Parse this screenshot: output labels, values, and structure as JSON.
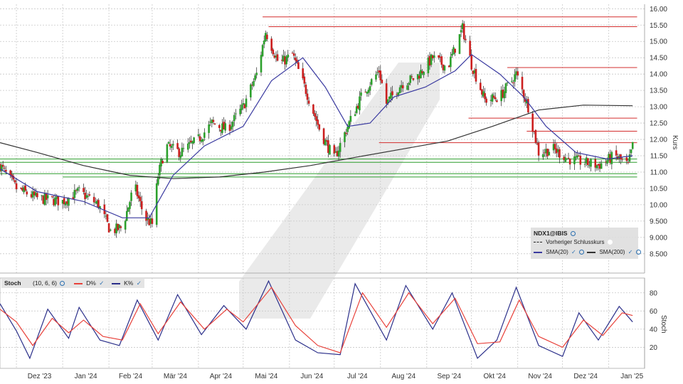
{
  "colors": {
    "up_candle": "#2ca02c",
    "down_candle": "#cc1f1f",
    "sma20": "#3a3aa0",
    "sma200": "#333333",
    "resistance": "#d32f2f",
    "support": "#2e9e2e",
    "stoch_d": "#e8413a",
    "stoch_k": "#2b2f8a",
    "grid": "#c8c8c8"
  },
  "legend": {
    "symbol": "NDX1@IBIS",
    "previous_close": "Vorheriger Schlusskurs",
    "sma20": "SMA(20)",
    "sma200": "SMA(200)"
  },
  "stoch_legend": {
    "name": "Stoch",
    "params": "(10, 6, 6)",
    "d": "D%",
    "k": "K%"
  },
  "chart_data": [
    {
      "type": "candlestick",
      "ylabel": "Kurs",
      "ylim": [
        8.0,
        16.2
      ],
      "yticks": [
        "16.00",
        "15.50",
        "15.00",
        "14.50",
        "14.00",
        "13.50",
        "13.00",
        "12.50",
        "12.00",
        "11.50",
        "11.00",
        "10.50",
        "10.00",
        "9.500",
        "9.000",
        "8.500"
      ],
      "xticks": [
        "Dez '23",
        "Jan '24",
        "Feb '24",
        "Mär '24",
        "Apr '24",
        "Mai '24",
        "Jun '24",
        "Jul '24",
        "Aug '24",
        "Sep '24",
        "Okt '24",
        "Nov '24",
        "Dez '24",
        "Jan '25"
      ],
      "grid": true,
      "close_path": [
        [
          "2023-11-20",
          11.2
        ],
        [
          "2023-12-01",
          10.5
        ],
        [
          "2023-12-15",
          10.2
        ],
        [
          "2024-01-01",
          10.1
        ],
        [
          "2024-01-12",
          10.4
        ],
        [
          "2024-01-25",
          10.0
        ],
        [
          "2024-02-02",
          9.2
        ],
        [
          "2024-02-10",
          9.3
        ],
        [
          "2024-02-18",
          10.6
        ],
        [
          "2024-02-25",
          9.6
        ],
        [
          "2024-03-01",
          9.4
        ],
        [
          "2024-03-05",
          10.9
        ],
        [
          "2024-03-10",
          11.8
        ],
        [
          "2024-03-20",
          11.6
        ],
        [
          "2024-04-01",
          12.0
        ],
        [
          "2024-04-10",
          12.5
        ],
        [
          "2024-04-20",
          12.3
        ],
        [
          "2024-05-01",
          13.0
        ],
        [
          "2024-05-10",
          14.0
        ],
        [
          "2024-05-16",
          15.3
        ],
        [
          "2024-05-25",
          14.3
        ],
        [
          "2024-06-03",
          14.6
        ],
        [
          "2024-06-12",
          13.5
        ],
        [
          "2024-06-22",
          12.2
        ],
        [
          "2024-07-01",
          11.4
        ],
        [
          "2024-07-10",
          12.4
        ],
        [
          "2024-07-20",
          13.4
        ],
        [
          "2024-07-31",
          14.1
        ],
        [
          "2024-08-05",
          13.1
        ],
        [
          "2024-08-15",
          13.7
        ],
        [
          "2024-08-25",
          13.9
        ],
        [
          "2024-09-05",
          14.5
        ],
        [
          "2024-09-15",
          14.2
        ],
        [
          "2024-09-25",
          15.4
        ],
        [
          "2024-10-01",
          14.3
        ],
        [
          "2024-10-10",
          13.2
        ],
        [
          "2024-10-20",
          13.3
        ],
        [
          "2024-10-31",
          14.0
        ],
        [
          "2024-11-08",
          13.0
        ],
        [
          "2024-11-15",
          11.6
        ],
        [
          "2024-11-25",
          11.7
        ],
        [
          "2024-12-05",
          11.4
        ],
        [
          "2024-12-15",
          11.3
        ],
        [
          "2024-12-25",
          11.2
        ],
        [
          "2025-01-05",
          11.5
        ],
        [
          "2025-01-14",
          11.2
        ],
        [
          "2025-01-17",
          11.8
        ]
      ],
      "sma20_path": [
        [
          "2023-11-20",
          11.1
        ],
        [
          "2023-12-15",
          10.4
        ],
        [
          "2024-01-15",
          10.1
        ],
        [
          "2024-02-10",
          9.6
        ],
        [
          "2024-02-28",
          9.6
        ],
        [
          "2024-03-15",
          10.9
        ],
        [
          "2024-04-05",
          11.8
        ],
        [
          "2024-05-01",
          12.4
        ],
        [
          "2024-05-20",
          13.8
        ],
        [
          "2024-06-10",
          14.5
        ],
        [
          "2024-06-25",
          13.6
        ],
        [
          "2024-07-10",
          12.4
        ],
        [
          "2024-07-25",
          12.5
        ],
        [
          "2024-08-10",
          13.3
        ],
        [
          "2024-08-31",
          13.6
        ],
        [
          "2024-09-20",
          14.1
        ],
        [
          "2024-10-01",
          14.6
        ],
        [
          "2024-10-20",
          14.0
        ],
        [
          "2024-11-05",
          13.3
        ],
        [
          "2024-11-20",
          12.4
        ],
        [
          "2024-12-10",
          11.6
        ],
        [
          "2024-12-31",
          11.4
        ],
        [
          "2025-01-17",
          11.5
        ]
      ],
      "sma200_path": [
        [
          "2023-11-20",
          11.9
        ],
        [
          "2023-12-15",
          11.6
        ],
        [
          "2024-01-15",
          11.2
        ],
        [
          "2024-02-15",
          10.9
        ],
        [
          "2024-03-15",
          10.8
        ],
        [
          "2024-04-15",
          10.85
        ],
        [
          "2024-05-15",
          11.0
        ],
        [
          "2024-06-15",
          11.2
        ],
        [
          "2024-07-15",
          11.45
        ],
        [
          "2024-08-15",
          11.7
        ],
        [
          "2024-09-15",
          11.95
        ],
        [
          "2024-10-15",
          12.4
        ],
        [
          "2024-11-15",
          12.9
        ],
        [
          "2024-12-15",
          13.05
        ],
        [
          "2025-01-17",
          13.03
        ]
      ],
      "resistance_lines": [
        {
          "y": 15.75,
          "from": "2024-05-14",
          "to": "2025-01-20"
        },
        {
          "y": 15.45,
          "from": "2024-05-18",
          "to": "2025-01-20"
        },
        {
          "y": 14.2,
          "from": "2024-10-25",
          "to": "2025-01-20"
        },
        {
          "y": 12.65,
          "from": "2024-09-29",
          "to": "2025-01-20"
        },
        {
          "y": 12.25,
          "from": "2024-11-07",
          "to": "2025-01-20"
        },
        {
          "y": 11.9,
          "from": "2024-07-31",
          "to": "2025-01-20"
        }
      ],
      "support_lines": [
        {
          "y": 11.4,
          "from": "2023-11-20",
          "to": "2025-01-20"
        },
        {
          "y": 11.3,
          "from": "2023-11-20",
          "to": "2025-01-20"
        },
        {
          "y": 10.95,
          "from": "2023-11-20",
          "to": "2025-01-20"
        },
        {
          "y": 10.85,
          "from": "2024-01-01",
          "to": "2025-01-20"
        }
      ]
    },
    {
      "type": "line",
      "ylabel": "Stoch",
      "ylim": [
        0,
        100
      ],
      "yticks": [
        "80",
        "60",
        "40",
        "20"
      ],
      "series": [
        {
          "name": "D%",
          "values": [
            [
              "2023-11-20",
              62
            ],
            [
              "2023-12-01",
              48
            ],
            [
              "2023-12-12",
              22
            ],
            [
              "2023-12-25",
              52
            ],
            [
              "2024-01-05",
              36
            ],
            [
              "2024-01-15",
              50
            ],
            [
              "2024-01-28",
              32
            ],
            [
              "2024-02-10",
              28
            ],
            [
              "2024-02-22",
              68
            ],
            [
              "2024-03-05",
              35
            ],
            [
              "2024-03-20",
              70
            ],
            [
              "2024-04-05",
              40
            ],
            [
              "2024-04-20",
              62
            ],
            [
              "2024-05-01",
              48
            ],
            [
              "2024-05-20",
              86
            ],
            [
              "2024-06-05",
              44
            ],
            [
              "2024-06-20",
              22
            ],
            [
              "2024-07-05",
              14
            ],
            [
              "2024-07-20",
              80
            ],
            [
              "2024-08-05",
              42
            ],
            [
              "2024-08-20",
              80
            ],
            [
              "2024-09-05",
              46
            ],
            [
              "2024-09-20",
              74
            ],
            [
              "2024-10-05",
              24
            ],
            [
              "2024-10-20",
              26
            ],
            [
              "2024-11-02",
              72
            ],
            [
              "2024-11-15",
              32
            ],
            [
              "2024-12-01",
              20
            ],
            [
              "2024-12-15",
              50
            ],
            [
              "2024-12-28",
              33
            ],
            [
              "2025-01-10",
              58
            ],
            [
              "2025-01-17",
              55
            ]
          ]
        },
        {
          "name": "K%",
          "values": [
            [
              "2023-11-20",
              68
            ],
            [
              "2023-12-01",
              38
            ],
            [
              "2023-12-10",
              8
            ],
            [
              "2023-12-22",
              62
            ],
            [
              "2024-01-05",
              30
            ],
            [
              "2024-01-12",
              64
            ],
            [
              "2024-01-26",
              28
            ],
            [
              "2024-02-08",
              22
            ],
            [
              "2024-02-20",
              72
            ],
            [
              "2024-03-05",
              28
            ],
            [
              "2024-03-18",
              78
            ],
            [
              "2024-04-03",
              34
            ],
            [
              "2024-04-18",
              66
            ],
            [
              "2024-05-03",
              40
            ],
            [
              "2024-05-18",
              93
            ],
            [
              "2024-06-05",
              28
            ],
            [
              "2024-06-20",
              14
            ],
            [
              "2024-07-05",
              12
            ],
            [
              "2024-07-15",
              90
            ],
            [
              "2024-08-05",
              28
            ],
            [
              "2024-08-18",
              88
            ],
            [
              "2024-09-05",
              40
            ],
            [
              "2024-09-18",
              80
            ],
            [
              "2024-10-05",
              8
            ],
            [
              "2024-10-18",
              28
            ],
            [
              "2024-10-31",
              86
            ],
            [
              "2024-11-15",
              22
            ],
            [
              "2024-12-01",
              10
            ],
            [
              "2024-12-12",
              58
            ],
            [
              "2024-12-25",
              28
            ],
            [
              "2025-01-08",
              65
            ],
            [
              "2025-01-17",
              48
            ]
          ]
        }
      ]
    }
  ]
}
